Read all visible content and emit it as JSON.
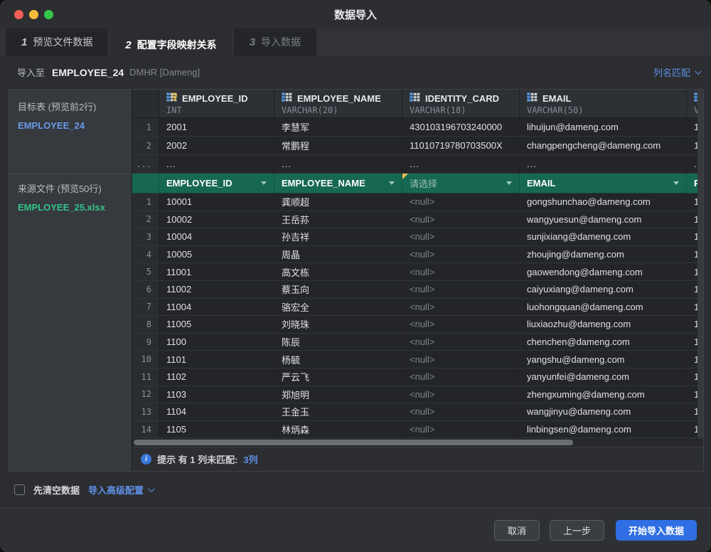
{
  "window": {
    "title": "数据导入"
  },
  "tabs": [
    {
      "num": "1",
      "label": "预览文件数据",
      "state": "inactive"
    },
    {
      "num": "2",
      "label": "配置字段映射关系",
      "state": "active"
    },
    {
      "num": "3",
      "label": "导入数据",
      "state": "disabled"
    }
  ],
  "toolbar": {
    "import_to_label": "导入至",
    "table_name": "EMPLOYEE_24",
    "schema": "DMHR [Dameng]",
    "column_match_label": "列名匹配"
  },
  "sidebar": {
    "target_label": "目标表 (预览前2行)",
    "target_table": "EMPLOYEE_24",
    "source_label": "来源文件 (预览50行)",
    "source_file": "EMPLOYEE_25.xlsx"
  },
  "table": {
    "columns": [
      {
        "name": "EMPLOYEE_ID",
        "type": "INT",
        "pk": true
      },
      {
        "name": "EMPLOYEE_NAME",
        "type": "VARCHAR(20)",
        "pk": false
      },
      {
        "name": "IDENTITY_CARD",
        "type": "VARCHAR(18)",
        "pk": false
      },
      {
        "name": "EMAIL",
        "type": "VARCHAR(50)",
        "pk": false
      },
      {
        "name": "",
        "type": "VA",
        "pk": false
      }
    ],
    "target_rows": [
      {
        "num": "1",
        "cells": [
          "2001",
          "李慧军",
          "430103196703240000",
          "lihuijun@dameng.com",
          "1"
        ]
      },
      {
        "num": "2",
        "cells": [
          "2002",
          "常鹏程",
          "11010719780703500X",
          "changpengcheng@dameng.com",
          "1"
        ]
      },
      {
        "num": "...",
        "cells": [
          "...",
          "...",
          "...",
          "...",
          "..."
        ]
      }
    ],
    "mapping_row": {
      "cells": [
        {
          "value": "EMPLOYEE_ID",
          "mapped": true,
          "warning": false
        },
        {
          "value": "EMPLOYEE_NAME",
          "mapped": true,
          "warning": false
        },
        {
          "value": "请选择",
          "mapped": false,
          "warning": true
        },
        {
          "value": "EMAIL",
          "mapped": true,
          "warning": false
        },
        {
          "value": "P",
          "mapped": true,
          "warning": false
        }
      ]
    },
    "source_rows": [
      {
        "num": "1",
        "cells": [
          "10001",
          "龚顺超",
          "<null>",
          "gongshunchao@dameng.com",
          "1"
        ]
      },
      {
        "num": "2",
        "cells": [
          "10002",
          "王岳荪",
          "<null>",
          "wangyuesun@dameng.com",
          "1"
        ]
      },
      {
        "num": "3",
        "cells": [
          "10004",
          "孙吉祥",
          "<null>",
          "sunjixiang@dameng.com",
          "1"
        ]
      },
      {
        "num": "4",
        "cells": [
          "10005",
          "周晶",
          "<null>",
          "zhoujing@dameng.com",
          "1"
        ]
      },
      {
        "num": "5",
        "cells": [
          "11001",
          "高文栋",
          "<null>",
          "gaowendong@dameng.com",
          "1"
        ]
      },
      {
        "num": "6",
        "cells": [
          "11002",
          "蔡玉向",
          "<null>",
          "caiyuxiang@dameng.com",
          "1"
        ]
      },
      {
        "num": "7",
        "cells": [
          "11004",
          "骆宏全",
          "<null>",
          "luohongquan@dameng.com",
          "1"
        ]
      },
      {
        "num": "8",
        "cells": [
          "11005",
          "刘晓珠",
          "<null>",
          "liuxiaozhu@dameng.com",
          "1"
        ]
      },
      {
        "num": "9",
        "cells": [
          "1100",
          "陈辰",
          "<null>",
          "chenchen@dameng.com",
          "1"
        ]
      },
      {
        "num": "10",
        "cells": [
          "1101",
          "杨毓",
          "<null>",
          "yangshu@dameng.com",
          "1"
        ]
      },
      {
        "num": "11",
        "cells": [
          "1102",
          "严云飞",
          "<null>",
          "yanyunfei@dameng.com",
          "1"
        ]
      },
      {
        "num": "12",
        "cells": [
          "1103",
          "郑旭明",
          "<null>",
          "zhengxuming@dameng.com",
          "1"
        ]
      },
      {
        "num": "13",
        "cells": [
          "1104",
          "王金玉",
          "<null>",
          "wangjinyu@dameng.com",
          "1"
        ]
      },
      {
        "num": "14",
        "cells": [
          "1105",
          "林炳森",
          "<null>",
          "linbingsen@dameng.com",
          "1"
        ]
      }
    ],
    "hint": {
      "text": "提示 有 1 列未匹配:",
      "link": "3列"
    }
  },
  "options": {
    "clear_checkbox_label": "先清空数据",
    "advanced_link": "导入高级配置"
  },
  "footer": {
    "cancel": "取消",
    "previous": "上一步",
    "start": "开始导入数据"
  },
  "colors": {
    "accent_blue": "#2f6ee3",
    "link_blue": "#5f8fe6",
    "mapping_green": "#176852",
    "source_file_green": "#33c48a",
    "target_table_blue": "#6a9be8",
    "warning_yellow": "#e8c15a"
  }
}
